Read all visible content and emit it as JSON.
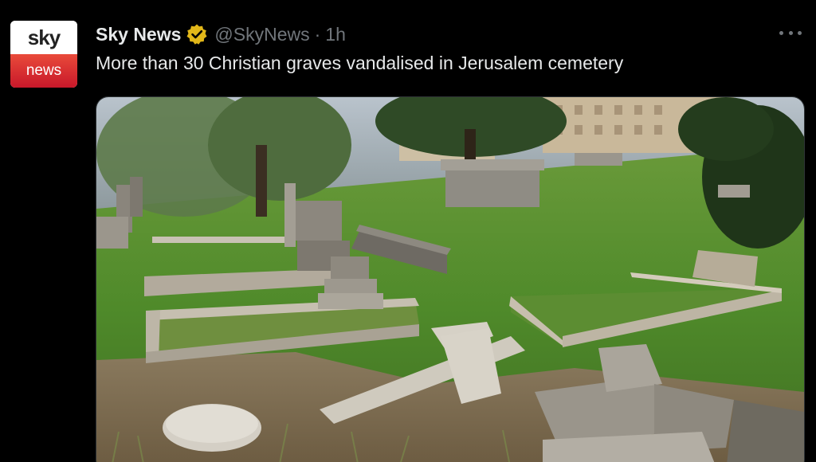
{
  "tweet": {
    "avatar": {
      "logo_top": "sky",
      "logo_bottom": "news"
    },
    "author": {
      "name": "Sky News",
      "handle": "@SkyNews",
      "separator": "·",
      "time": "1h",
      "verified_icon": "verified-badge-icon"
    },
    "text": "More than 30 Christian graves vandalised in Jerusalem cemetery",
    "more_icon": "more-options-icon",
    "media": {
      "kind": "photo",
      "subject": "cemetery-with-toppled-gravestones"
    }
  },
  "colors": {
    "background": "#000000",
    "text_primary": "#e7e9ea",
    "text_secondary": "#71767b",
    "verified_gold": "#e2b719",
    "sky_red": "#d92a2f"
  }
}
